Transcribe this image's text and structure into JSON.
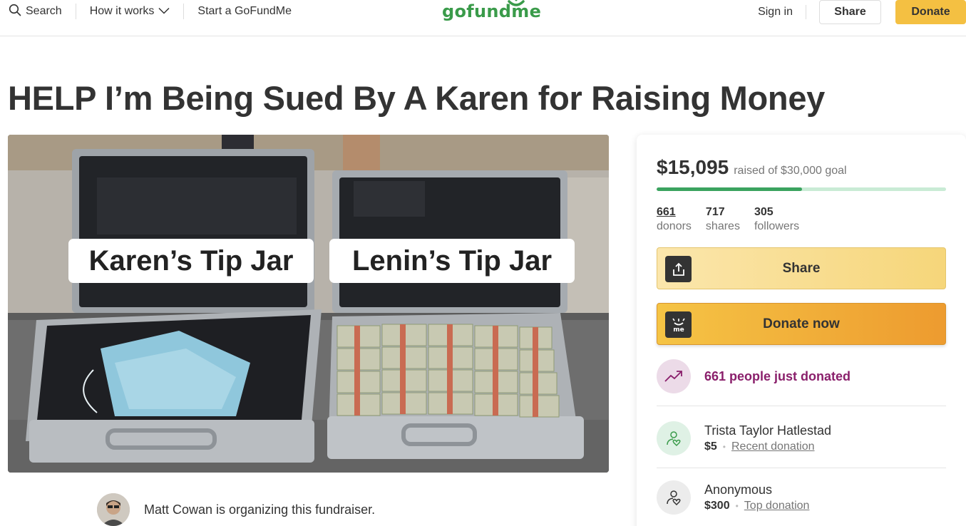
{
  "header": {
    "search_label": "Search",
    "how_it_works_label": "How it works",
    "start_label": "Start a GoFundMe",
    "logo_text": "gofundme",
    "signin_label": "Sign in",
    "share_label": "Share",
    "donate_label": "Donate"
  },
  "campaign": {
    "title": "HELP I’m Being Sued By A Karen for Raising Money",
    "hero_label_left": "Karen’s Tip Jar",
    "hero_label_right": "Lenin’s Tip Jar",
    "organizer_text": "Matt Cowan is organizing this fundraiser."
  },
  "sidebar": {
    "raised": "$15,095",
    "goal_text": "raised of $30,000 goal",
    "progress_fraction": 0.503,
    "stats": [
      {
        "value": "661",
        "label": "donors"
      },
      {
        "value": "717",
        "label": "shares"
      },
      {
        "value": "305",
        "label": "followers"
      }
    ],
    "share_button": "Share",
    "donate_button": "Donate now",
    "donate_icon_text": "me",
    "trending_text": "661 people just donated",
    "donations": [
      {
        "name": "Trista Taylor Hatlestad",
        "amount": "$5",
        "tag": "Recent donation"
      },
      {
        "name": "Anonymous",
        "amount": "$300",
        "tag": "Top donation"
      }
    ]
  },
  "colors": {
    "brand_green": "#3a9b4a",
    "donate_yellow": "#f4c042",
    "progress_green": "#3ba35f",
    "trending_purple": "#8a1f6b"
  },
  "icons": [
    "search-icon",
    "chevron-down-icon",
    "share-upload-icon",
    "gofundme-me-icon",
    "trending-up-icon",
    "donor-heart-icon"
  ]
}
